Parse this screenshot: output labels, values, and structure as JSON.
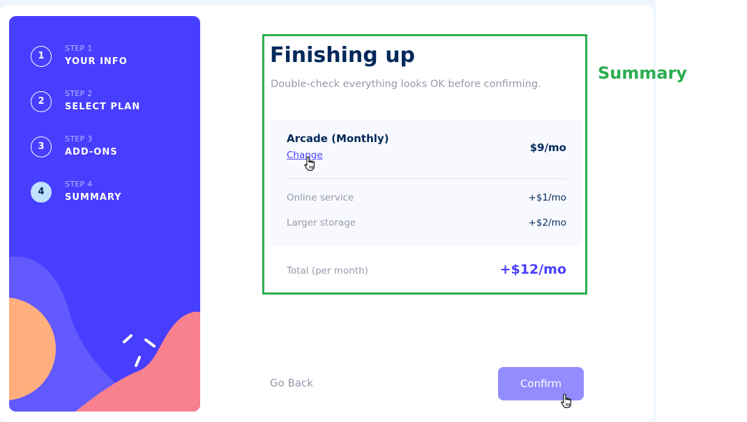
{
  "sidebar": {
    "steps": [
      {
        "number": "1",
        "label": "STEP 1",
        "title": "YOUR INFO",
        "active": false
      },
      {
        "number": "2",
        "label": "STEP 2",
        "title": "SELECT PLAN",
        "active": false
      },
      {
        "number": "3",
        "label": "STEP 3",
        "title": "ADD-ONS",
        "active": false
      },
      {
        "number": "4",
        "label": "STEP 4",
        "title": "SUMMARY",
        "active": true
      }
    ]
  },
  "main": {
    "title": "Finishing up",
    "subtitle": "Double-check everything looks OK before confirming.",
    "plan": {
      "name": "Arcade (Monthly)",
      "change_label": "Change",
      "price": "$9/mo"
    },
    "addons": [
      {
        "name": "Online service",
        "price": "+$1/mo"
      },
      {
        "name": "Larger storage",
        "price": "+$2/mo"
      }
    ],
    "total": {
      "label": "Total (per month)",
      "price": "+$12/mo"
    }
  },
  "footer": {
    "back_label": "Go Back",
    "confirm_label": "Confirm"
  },
  "annotation": {
    "label": "Summary",
    "color": "#2bad4f"
  },
  "colors": {
    "sidebar_bg": "#483eff",
    "title": "#02295a",
    "accent": "#483eff",
    "confirm_bg": "#928cff",
    "active_step": "#bfe2fd"
  },
  "icons": [
    "hand-pointer-cursor-icon"
  ]
}
